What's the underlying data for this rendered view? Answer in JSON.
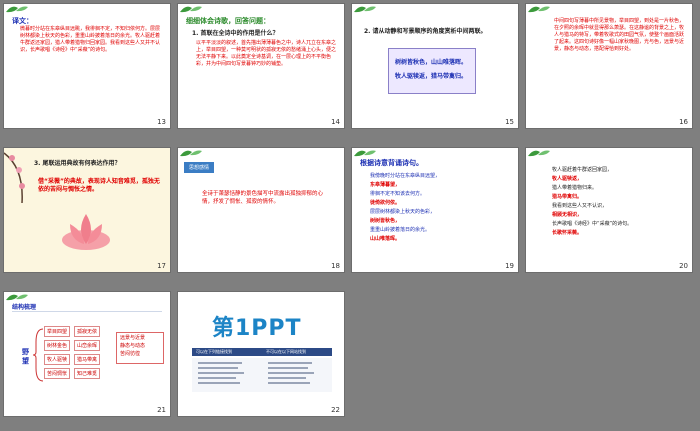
{
  "slides": {
    "s13": {
      "num": "13",
      "title": "译文：",
      "body": "微暮时分站在东皋纵目远眺，我徘徊不定，不知归依何方。层层树林都染上秋天的色彩，重重山岭披着落日的余光。牧人驱赶着牛群返还家园，猎人带着猎物归回家园。我看到这些人又并不认识，长声歌唱《诗经》中“采薇”的诗句。"
    },
    "s14": {
      "num": "14",
      "title": "细细体会诗歌，回答问题：",
      "question": "1. 首联在全诗中的作用是什么？",
      "answer": "以平平淡淡的叙述，首先描出薄薄暮色之中，诗人兀立在东皋之上，举目四望，一种莫可明状的孤寂无依的愁绪涌上心头，便之无法平静下来。以此奠定全诗基调，在一层心理上的不平衡色彩，并为中间四句写景暮钟巧妙的铺垫。"
    },
    "s15": {
      "num": "15",
      "question": "2. 请从动静和写景顺序的角度赏析中间两联。",
      "lines": [
        "树树皆秋色，山山唯落晖。",
        "牧人驱犊返，猎马带禽归。"
      ]
    },
    "s16": {
      "num": "16",
      "body": "中间四句写薄暮中所见景物，举目四望，到处是一片秋色，在夕照的余晖中就显得那么萧瑟。在这静谧的背景之上，牧人与猎马的特写，带着牧歌式的田园气氛，使整个画面活跃了起来。这四句诗好像一幅山家秋晚图，光与色，远景与近景，静态与动态，搭配得恰到好处。"
    },
    "s17": {
      "num": "17",
      "question": "3. 尾联运用典故有何表达作用？",
      "answer": "借“采薇”的典故，表现诗人知音难觅，孤独无依的苦闷与惆怅之情。"
    },
    "s18": {
      "num": "18",
      "tag": "思想感情",
      "body": "全诗于萧瑟恬静的景色描写中流露出孤独抑郁的心情，抒发了惆怅、孤寂的情怀。"
    },
    "s19": {
      "num": "19",
      "title": "根据诗意背诵诗句。",
      "lines": [
        {
          "text": "我傍晚时分站在东皋纵目远望，",
          "color": "blue"
        },
        {
          "text": "东皋薄暮望，",
          "color": "red"
        },
        {
          "text": "徘徊不定不知该去何方。",
          "color": "blue"
        },
        {
          "text": "徙倚欲何依。",
          "color": "red"
        },
        {
          "text": "层层树林都染上秋天的色彩，",
          "color": "blue"
        },
        {
          "text": "树树皆秋色，",
          "color": "red"
        },
        {
          "text": "重重山岭披着落日的余光。",
          "color": "blue"
        },
        {
          "text": "山山唯落晖。",
          "color": "red"
        }
      ]
    },
    "s20": {
      "num": "20",
      "lines": [
        {
          "text": "牧人驱赶着牛群返回家园，",
          "color": "dark"
        },
        {
          "text": "牧人驱犊返，",
          "color": "red"
        },
        {
          "text": "猎人带着猎物归来。",
          "color": "dark"
        },
        {
          "text": "猎马带禽归。",
          "color": "red"
        },
        {
          "text": "我看到这些人又不认识，",
          "color": "dark"
        },
        {
          "text": "相顾无相识，",
          "color": "red"
        },
        {
          "text": "长声歌唱《诗经》中“采薇”的诗句。",
          "color": "dark"
        },
        {
          "text": "长歌怀采薇。",
          "color": "red"
        }
      ]
    },
    "s21": {
      "num": "21",
      "title": "结构梳理",
      "root": "野望",
      "branches": [
        [
          "举目四望",
          "孤寂无依"
        ],
        [
          "树林金色",
          "山峦余晖"
        ],
        [
          "牧人驱犊",
          "猎马带禽"
        ],
        [
          "苦闷惆怅",
          "知己难觅"
        ]
      ],
      "results": [
        "远景与近景",
        "静态与动态",
        "苦闷彷徨"
      ]
    },
    "s22": {
      "num": "22",
      "logo": "第1PPT",
      "left_note": "可以在下列链接找到",
      "right_note": "不可以在以下网站找到"
    }
  },
  "colors": {
    "accent_blue": "#1c2fb3",
    "accent_red": "#e00000",
    "title_green": "#2a8a2a",
    "banner_blue": "#2c4a86"
  }
}
